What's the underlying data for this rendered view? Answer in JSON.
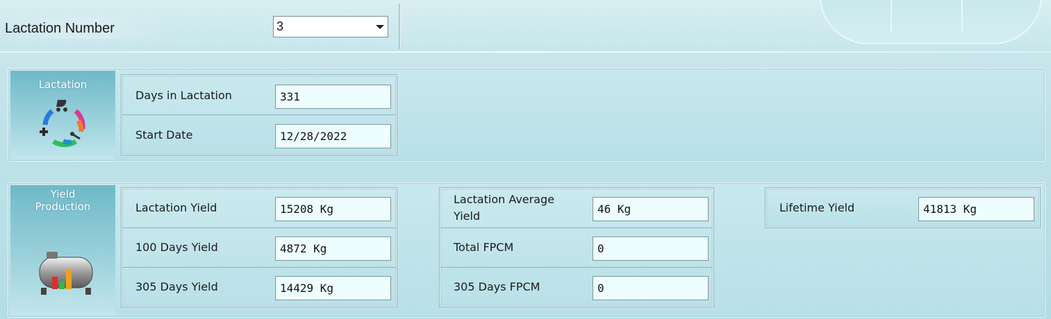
{
  "header": {
    "lactation_number_label": "Lactation Number",
    "lactation_number_value": "3"
  },
  "lactation_panel": {
    "title": "Lactation",
    "icon": "lactation-cycle-icon",
    "fields": [
      {
        "label": "Days in Lactation",
        "value": "331"
      },
      {
        "label": "Start Date",
        "value": "12/28/2022"
      }
    ]
  },
  "yield_panel": {
    "title_line1": "Yield",
    "title_line2": "Production",
    "icon": "milk-tank-chart-icon",
    "group1": [
      {
        "label": "Lactation Yield",
        "value": "15208 Kg"
      },
      {
        "label": "100 Days Yield",
        "value": "4872 Kg"
      },
      {
        "label": "305 Days Yield",
        "value": "14429 Kg"
      }
    ],
    "group2": [
      {
        "label_line1": "Lactation Average",
        "label_line2": "Yield",
        "value": "46 Kg"
      },
      {
        "label": "Total FPCM",
        "value": "0"
      },
      {
        "label": "305 Days FPCM",
        "value": "0"
      }
    ],
    "group3": [
      {
        "label": "Lifetime Yield",
        "value": "41813 Kg"
      }
    ]
  },
  "colors": {
    "background": "#bfe2e8",
    "panel_header": "#6fb9c8",
    "value_field": "#eefeff"
  }
}
